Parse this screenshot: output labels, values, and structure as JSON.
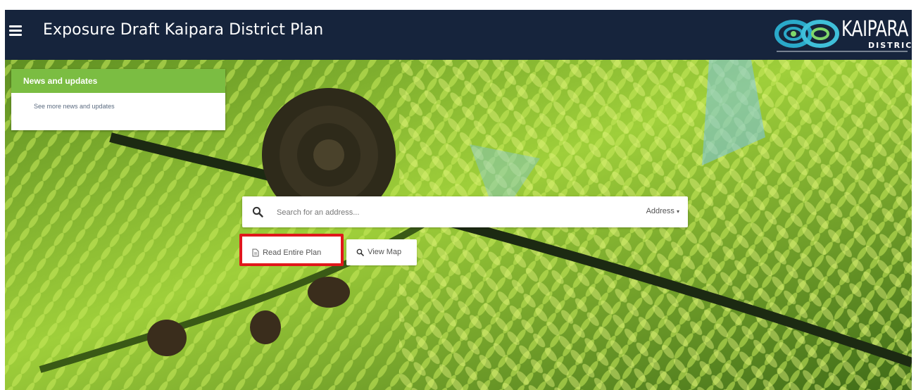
{
  "header": {
    "title": "Exposure Draft Kaipara District Plan",
    "logo_word": "KAIPARA",
    "logo_sub": "DISTRICT"
  },
  "news": {
    "heading": "News and updates",
    "link": "See more news and updates"
  },
  "search": {
    "placeholder": "Search for an address...",
    "mode": "Address"
  },
  "actions": {
    "read_plan": "Read Entire Plan",
    "view_map": "View Map"
  },
  "icons": {
    "menu": "hamburger-menu-icon",
    "search": "magnifier-icon",
    "read": "document-icon",
    "map": "magnifier-icon"
  },
  "colors": {
    "header_bg": "#16243c",
    "news_header": "#7bbd42",
    "highlight": "#e0171c"
  }
}
